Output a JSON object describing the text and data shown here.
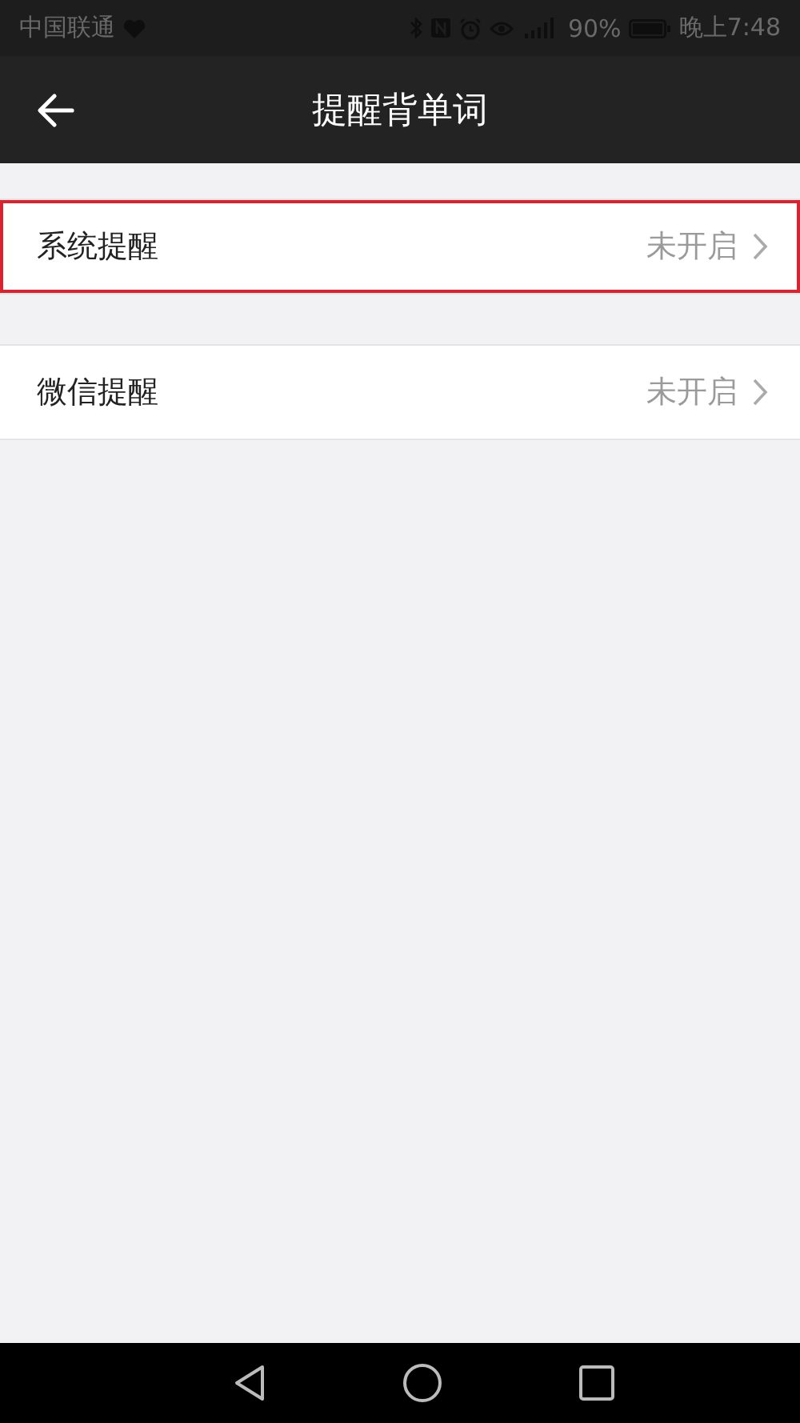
{
  "status_bar": {
    "carrier": "中国联通",
    "battery": "90%",
    "time": "晚上7:48"
  },
  "header": {
    "title": "提醒背单词"
  },
  "sections": [
    {
      "rows": [
        {
          "label": "系统提醒",
          "value": "未开启",
          "highlighted": true
        }
      ]
    },
    {
      "rows": [
        {
          "label": "微信提醒",
          "value": "未开启",
          "highlighted": false
        }
      ]
    }
  ]
}
